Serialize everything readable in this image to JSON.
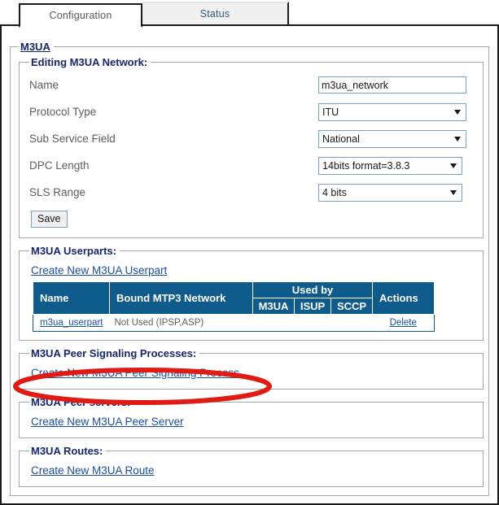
{
  "tabs": [
    {
      "label": "Configuration",
      "active": true
    },
    {
      "label": "Status",
      "active": false
    }
  ],
  "outer_section": {
    "legend": "M3UA"
  },
  "editing_section": {
    "legend": "Editing M3UA Network:",
    "fields": [
      {
        "label": "Name",
        "type": "text",
        "value": "m3ua_network",
        "placeholder": ""
      },
      {
        "label": "Protocol Type",
        "type": "select",
        "value": "ITU"
      },
      {
        "label": "Sub Service Field",
        "type": "select",
        "value": "National"
      },
      {
        "label": "DPC Length",
        "type": "select",
        "value": "14bits format=3.8.3"
      },
      {
        "label": "SLS Range",
        "type": "select",
        "value": "4 bits"
      }
    ],
    "save_label": "Save"
  },
  "userparts_section": {
    "legend": "M3UA Userparts:",
    "create_link": "Create New M3UA Userpart",
    "table": {
      "headers": {
        "name": "Name",
        "bound": "Bound MTP3 Network",
        "used_by": "Used by",
        "used_by_sub": [
          "M3UA",
          "ISUP",
          "SCCP"
        ],
        "actions": "Actions"
      },
      "rows": [
        {
          "name": "m3ua_userpart",
          "bound": "Not Used (IPSP,ASP)",
          "m3ua": "",
          "isup": "",
          "sccp": "",
          "action": "Delete"
        }
      ]
    }
  },
  "psp_section": {
    "legend": "M3UA Peer Signaling Processes:",
    "create_link": "Create New M3UA Peer Signaling Process"
  },
  "peerservers_section": {
    "legend": "M3UA Peer servers:",
    "create_link": "Create New M3UA Peer Server"
  },
  "routes_section": {
    "legend": "M3UA Routes:",
    "create_link": "Create New M3UA Route"
  },
  "annotation": {
    "shape": "ellipse",
    "color": "#E01B14",
    "target": "Create New M3UA Peer Signaling Process"
  },
  "colors": {
    "table_header_blue": "#0F5C8C",
    "legend_navy": "#16276B",
    "link_blue": "#1A4FA0",
    "annotation_red": "#E01B14",
    "field_border": "#7AA0C4"
  }
}
